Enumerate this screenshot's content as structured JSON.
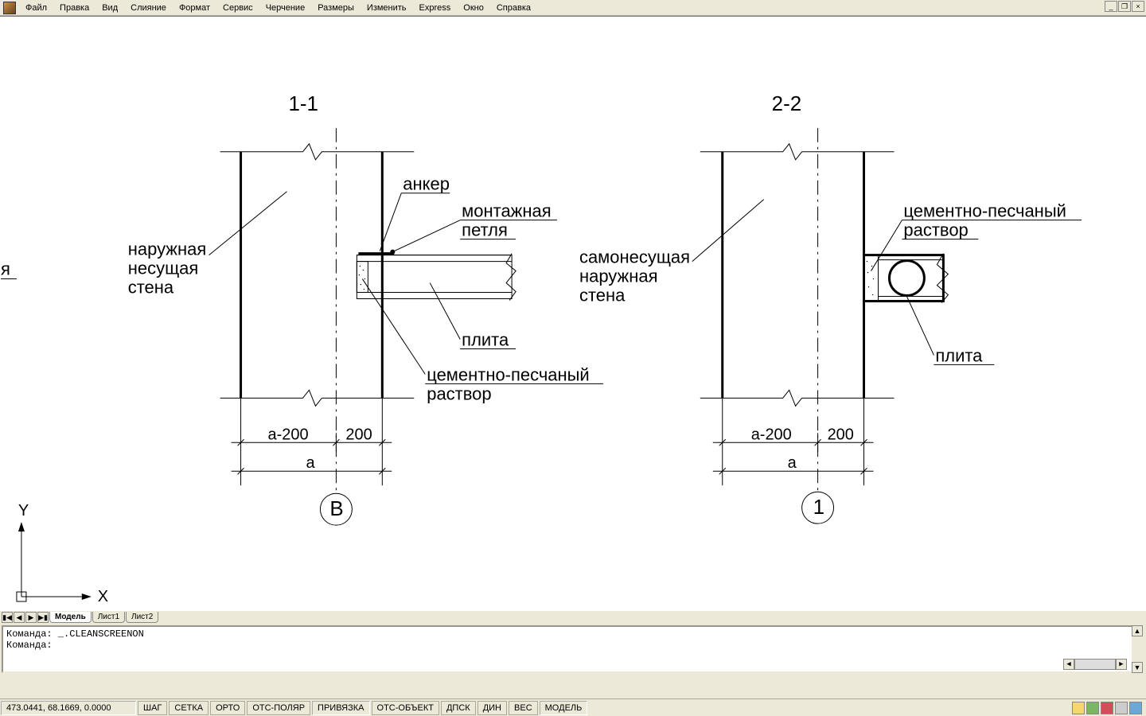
{
  "menu": {
    "items": [
      "Файл",
      "Правка",
      "Вид",
      "Слияние",
      "Формат",
      "Сервис",
      "Черчение",
      "Размеры",
      "Изменить",
      "Express",
      "Окно",
      "Справка"
    ]
  },
  "win": {
    "minimize": "_",
    "restore": "❐",
    "close": "×"
  },
  "drawing": {
    "axes": {
      "y": "Y",
      "x": "X"
    },
    "section11": {
      "title": "1-1",
      "label_wall": "наружная\nнесущая\nстена",
      "label_anchor": "анкер",
      "label_loop": "монтажная\nпетля",
      "label_slab": "плита",
      "label_mortar": "цементно-песчаный\nраствор",
      "dim_a": "а",
      "dim_a200": "а-200",
      "dim_200": "200",
      "axis_mark": "В"
    },
    "section22": {
      "title": "2-2",
      "label_wall": "самонесущая\nнаружная\nстена",
      "label_mortar": "цементно-песчаный\nраствор",
      "label_slab": "плита",
      "dim_a": "а",
      "dim_a200": "а-200",
      "dim_200": "200",
      "axis_mark": "1"
    },
    "frag_left": "я"
  },
  "tabs": {
    "model": "Модель",
    "sheet1": "Лист1",
    "sheet2": "Лист2"
  },
  "command": {
    "line1": "Команда: _.CLEANSCREENON",
    "line2": "Команда:"
  },
  "status": {
    "coords": "473.0441, 68.1669, 0.0000",
    "toggles": [
      "ШАГ",
      "СЕТКА",
      "ОРТО",
      "ОТС-ПОЛЯР",
      "ПРИВЯЗКА",
      "ОТС-ОБЪЕКТ",
      "ДПСК",
      "ДИН",
      "ВЕС",
      "МОДЕЛЬ"
    ]
  }
}
